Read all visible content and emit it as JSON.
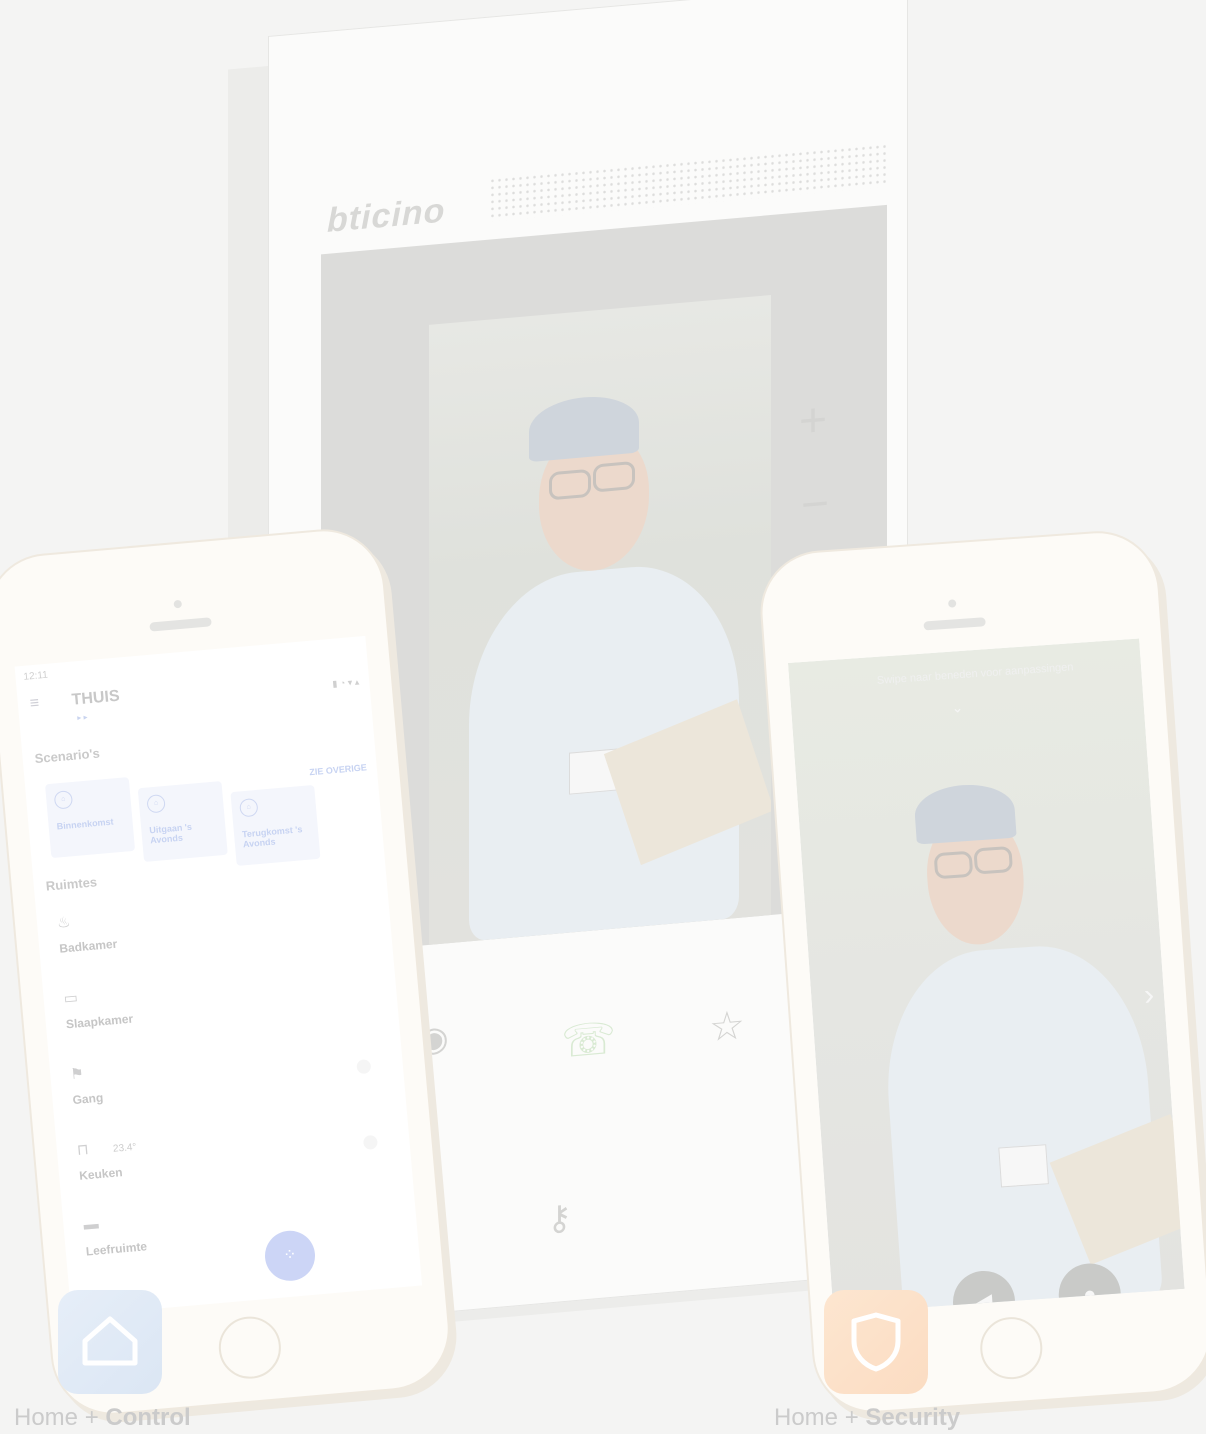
{
  "monitor": {
    "brand": "bticino"
  },
  "app_left": {
    "status_time": "12:11",
    "title": "THUIS",
    "section_scenarios": "Scenario's",
    "see_more": "ZIE OVERIGE",
    "scenarios": [
      {
        "label": "Binnenkomst",
        "icon": "scenario-icon"
      },
      {
        "label": "Uitgaan 's Avonds",
        "icon": "scenario-icon"
      },
      {
        "label": "Terugkomst 's Avonds",
        "icon": "scenario-icon"
      }
    ],
    "section_rooms": "Ruimtes",
    "rooms": [
      {
        "label": "Badkamer",
        "icon": "bath-icon",
        "temp": ""
      },
      {
        "label": "Slaapkamer",
        "icon": "bed-icon",
        "temp": ""
      },
      {
        "label": "Gang",
        "icon": "hallway-icon",
        "temp": ""
      },
      {
        "label": "Keuken",
        "icon": "kitchen-icon",
        "temp": "23.4°"
      },
      {
        "label": "Leefruimte",
        "icon": "sofa-icon",
        "temp": ""
      }
    ]
  },
  "app_right": {
    "hint": "Swipe naar beneden voor aanpassingen"
  },
  "badges": [
    {
      "prefix": "Home + ",
      "name": "Control",
      "color": "#dbe6f4",
      "icon": "home-icon"
    },
    {
      "prefix": "Home + ",
      "name": "Security",
      "color": "#fbdcc2",
      "icon": "shield-icon"
    }
  ]
}
